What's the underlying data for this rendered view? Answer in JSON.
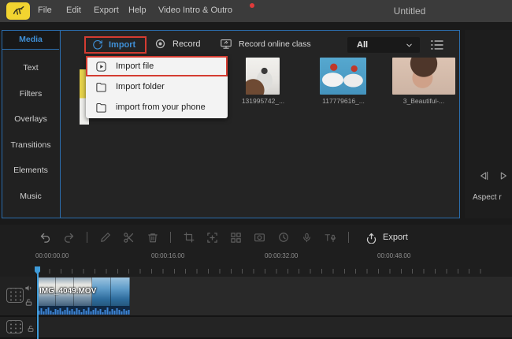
{
  "window": {
    "title": "Untitled"
  },
  "menu": {
    "items": [
      "File",
      "Edit",
      "Export",
      "Help",
      "Video Intro & Outro"
    ]
  },
  "sidebar": {
    "tabs": [
      "Media",
      "Text",
      "Filters",
      "Overlays",
      "Transitions",
      "Elements",
      "Music"
    ]
  },
  "media_panel": {
    "import_button": "Import",
    "record_button": "Record",
    "record_online_button": "Record online class",
    "filter_dropdown": "All",
    "import_menu": [
      {
        "label": "Import file",
        "highlighted": true
      },
      {
        "label": "Import folder",
        "highlighted": false
      },
      {
        "label": "import from your phone",
        "highlighted": false
      }
    ],
    "items": [
      {
        "name": "131995742_..."
      },
      {
        "name": "117779616_..."
      },
      {
        "name": "3_Beautiful-..."
      }
    ]
  },
  "preview": {
    "aspect_label": "Aspect r"
  },
  "toolbar": {
    "export_label": "Export",
    "icons": [
      "undo",
      "redo",
      "edit-pencil",
      "scissors-cut",
      "trash-delete",
      "crop",
      "zoom-region",
      "split-grid",
      "snapshot",
      "duration-clock",
      "microphone-voiceover",
      "text-to-speech",
      "export-share"
    ]
  },
  "timeline": {
    "ruler": [
      "00:00:00.00",
      "00:00:16.00",
      "00:00:32.00",
      "00:00:48.00"
    ],
    "clip_name": "IMG_4049.MOV"
  },
  "colors": {
    "accent_blue": "#3f8fd6",
    "border_blue": "#2b6dad",
    "highlight_red": "#d43c31",
    "logo_yellow": "#f2d430",
    "playhead_blue": "#3f9bd8"
  }
}
